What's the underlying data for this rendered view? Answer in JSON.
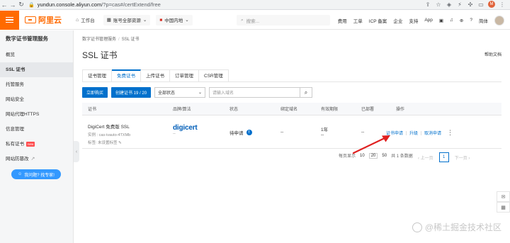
{
  "browser": {
    "url_host": "yundun.console.aliyun.com",
    "url_path": "/?p=cas#/certExtend/free",
    "profile_initial": "M"
  },
  "topbar": {
    "logo_text": "阿里云",
    "workbench": "工作台",
    "account_select": "账号全部资源",
    "region_select": "中国内地",
    "search_placeholder": "搜索...",
    "nav": [
      "费用",
      "工单",
      "ICP 备案",
      "企业",
      "支持",
      "App"
    ],
    "lang": "简体"
  },
  "sidebar": {
    "title": "数字证书管理服务",
    "items": [
      {
        "label": "概览"
      },
      {
        "label": "SSL 证书"
      },
      {
        "label": "托管服务"
      },
      {
        "label": "网站安全"
      },
      {
        "label": "网站代理HTTPS"
      },
      {
        "label": "信息管理"
      },
      {
        "label": "私有证书",
        "badge": "new"
      },
      {
        "label": "网站防篡改"
      }
    ],
    "promo_label": "我问题? 找专家!"
  },
  "main": {
    "breadcrumb": [
      "数字证书管理服务",
      "SSL 证书"
    ],
    "title": "SSL 证书",
    "help": "帮助文档",
    "tabs": [
      "证书管理",
      "免费证书",
      "上传证书",
      "订单管理",
      "CSR管理"
    ],
    "toolbar": {
      "buy": "立即购买",
      "create": "创建证书 19 / 20",
      "status_select": "全部状态",
      "keyword_placeholder": "请输入域名"
    },
    "columns": [
      "证书",
      "品牌/算法",
      "状态",
      "绑定域名",
      "有效期限",
      "已部署",
      "操作"
    ],
    "row": {
      "name": "DigiCert 免费版 SSL",
      "instance": "实例 : cas-ivauto-4TXMb",
      "tag": "标签: 未设置标签",
      "brand": "digicert",
      "brand_sub": "--",
      "status": "待申请",
      "domain": "--",
      "validity": "1年",
      "validity_sub": "--",
      "deployed": "--",
      "ops": [
        "证书申请",
        "升级",
        "取消申请"
      ]
    },
    "pager": {
      "per_page_label": "每页显示",
      "sizes": [
        "10",
        "20",
        "50"
      ],
      "total": "共 1 条数据",
      "prev": "上一页",
      "page": "1",
      "next": "下一页"
    }
  },
  "watermark": "@稀土掘金技术社区",
  "colors": {
    "brand": "#ff6a00",
    "primary": "#0070cc",
    "arrow": "#e02020"
  }
}
